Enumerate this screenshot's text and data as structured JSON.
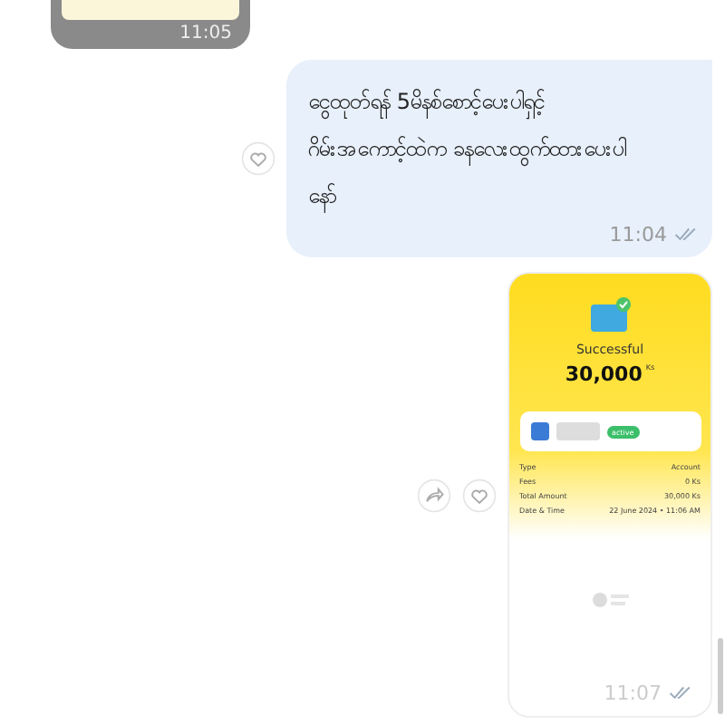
{
  "messages": [
    {
      "kind": "image",
      "time": "11:05"
    },
    {
      "kind": "text",
      "text": "ငွေထုတ်ရန် 5မိနစ်စောင့်ပေးပါရှင့်\nဂိမ်းအကောင့်ထဲက ခနလေးထွက်ထားပေးပါ\nနော်",
      "time": "11:04",
      "read": true
    },
    {
      "kind": "receipt",
      "status": "Successful",
      "amount": "30,000",
      "currency": "Ks",
      "badge": "active",
      "rows": [
        {
          "label": "Type",
          "value": "Account"
        },
        {
          "label": "Fees",
          "value": "0 Ks"
        },
        {
          "label": "Total Amount",
          "value": "30,000 Ks"
        },
        {
          "label": "Date & Time",
          "value": "22 June 2024 • 11:06 AM"
        }
      ],
      "time": "11:07",
      "read": true
    }
  ]
}
